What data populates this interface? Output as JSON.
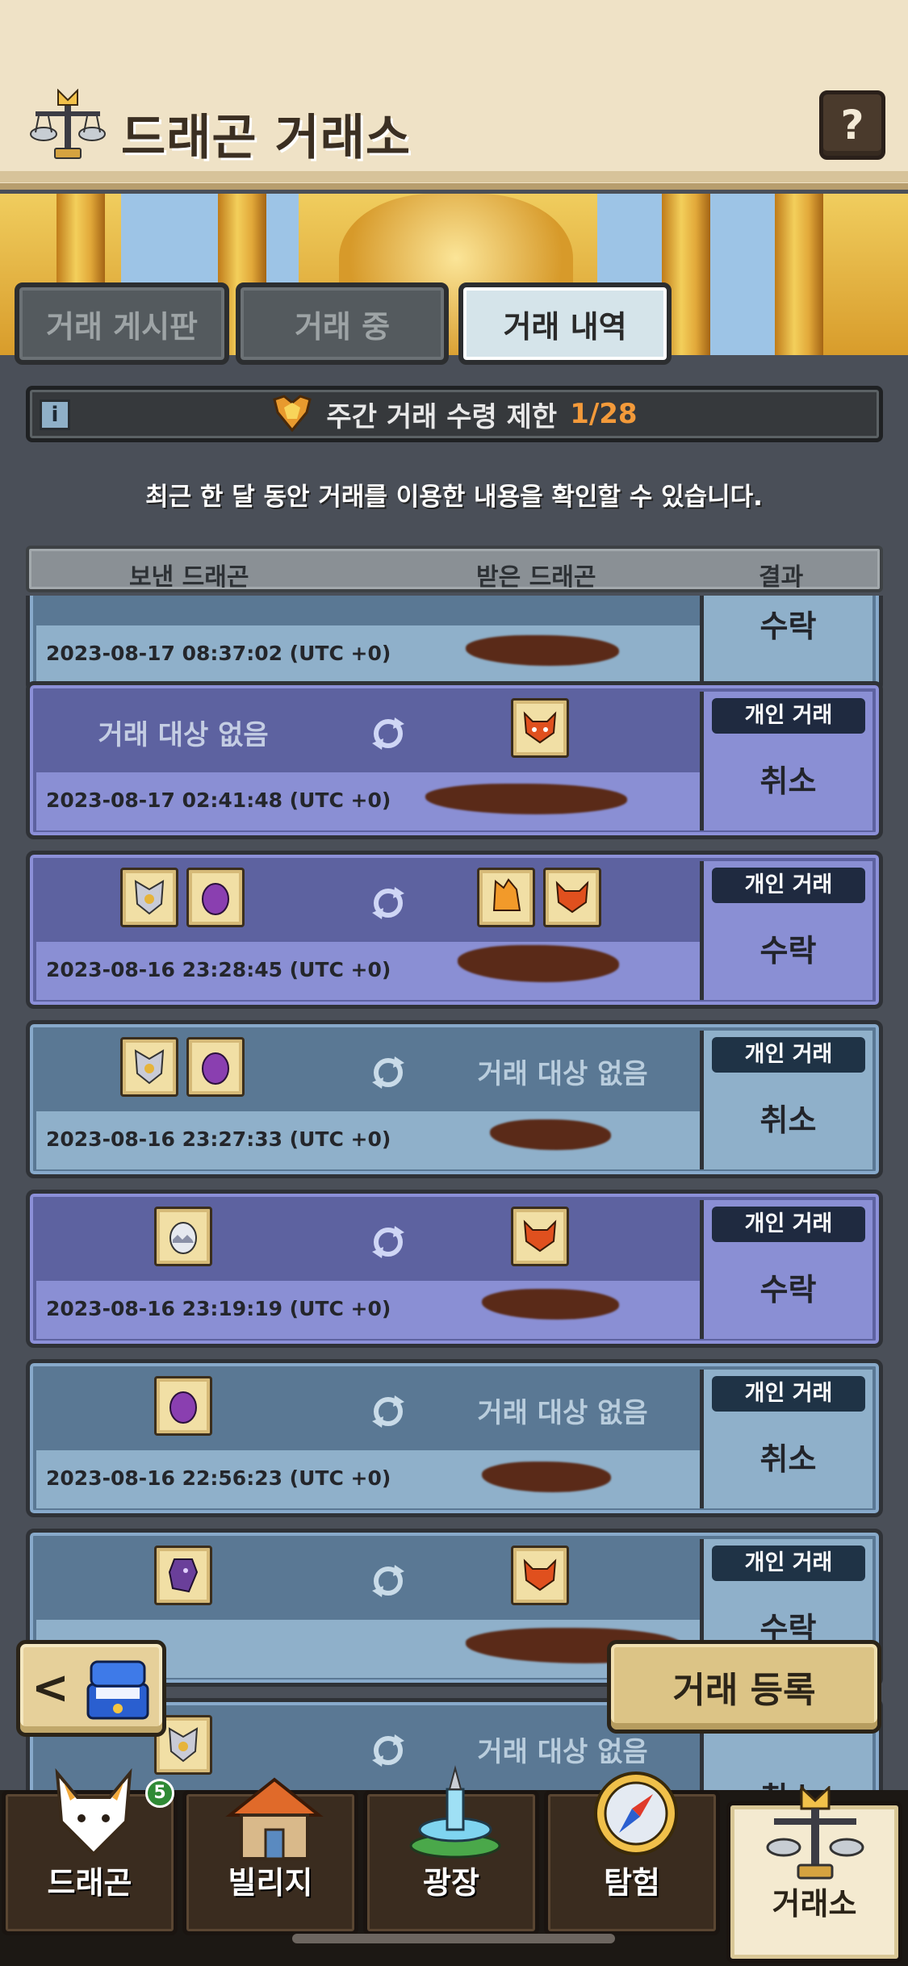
{
  "header": {
    "title": "드래곤 거래소",
    "help_label": "?"
  },
  "tabs": [
    {
      "label": "거래 게시판",
      "active": false
    },
    {
      "label": "거래 중",
      "active": false
    },
    {
      "label": "거래 내역",
      "active": true
    }
  ],
  "limit": {
    "label": "주간 거래 수령 제한",
    "value": "1/28"
  },
  "notice": "최근 한 달 동안 거래를 이용한 내용을 확인할 수 있습니다.",
  "columns": {
    "sent": "보낸 드래곤",
    "received": "받은 드래곤",
    "result": "결과"
  },
  "rows": [
    {
      "timestamp": "2023-08-17 08:37:02 (UTC +0)",
      "result": "수락",
      "kind": "cancel",
      "partial": true
    },
    {
      "timestamp": "2023-08-17 02:41:48 (UTC +0)",
      "type": "개인 거래",
      "result": "취소",
      "kind": "accept",
      "sent_empty": "거래 대상 없음"
    },
    {
      "timestamp": "2023-08-16 23:28:45 (UTC +0)",
      "type": "개인 거래",
      "result": "수락",
      "kind": "accept"
    },
    {
      "timestamp": "2023-08-16 23:27:33 (UTC +0)",
      "type": "개인 거래",
      "result": "취소",
      "kind": "cancel",
      "received_empty": "거래 대상 없음"
    },
    {
      "timestamp": "2023-08-16 23:19:19 (UTC +0)",
      "type": "개인 거래",
      "result": "수락",
      "kind": "accept"
    },
    {
      "timestamp": "2023-08-16 22:56:23 (UTC +0)",
      "type": "개인 거래",
      "result": "취소",
      "kind": "cancel",
      "received_empty": "거래 대상 없음"
    },
    {
      "type": "개인 거래",
      "result": "수락",
      "kind": "cancel"
    },
    {
      "result": "취소",
      "kind": "cancel",
      "received_empty": "거래 대상 없음"
    }
  ],
  "buttons": {
    "back": "<",
    "register": "거래 등록"
  },
  "nav": [
    {
      "label": "드래곤",
      "badge": "5",
      "icon": "fox-dragon-icon"
    },
    {
      "label": "빌리지",
      "icon": "house-icon"
    },
    {
      "label": "광장",
      "icon": "fountain-icon"
    },
    {
      "label": "탐험",
      "icon": "compass-icon"
    },
    {
      "label": "거래소",
      "icon": "scale-icon",
      "active": true
    }
  ],
  "colors": {
    "limit_value": "#f39a3a",
    "accept_row": "#5d62a0",
    "cancel_row": "#5a7894",
    "header_bg": "#efe2c6"
  }
}
